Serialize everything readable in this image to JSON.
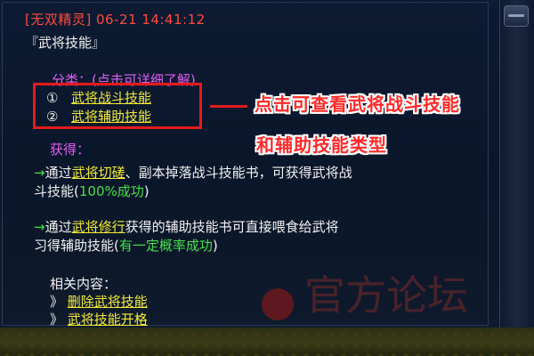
{
  "header": {
    "text": "[无双精灵] 06-21 14:41:12"
  },
  "title": "『武将技能』",
  "category_label": "分类：(点击可详细了解)",
  "options": [
    {
      "num": "①",
      "label": "武将战斗技能"
    },
    {
      "num": "②",
      "label": "武将辅助技能"
    }
  ],
  "annotation": {
    "line1": "点击可查看武将战斗技能",
    "line2": "和辅助技能类型"
  },
  "gain": {
    "label": "获得：",
    "p1": {
      "arrow": "→",
      "pre": "通过",
      "link": "武将切磋",
      "post": "、副本掉落战斗技能书，可获得武将战",
      "line2_pre": "斗技能(",
      "line2_pct": "100%成功",
      "line2_post": ")"
    },
    "p2": {
      "arrow": "→",
      "pre": "通过",
      "link": "武将修行",
      "post": "获得的辅助技能书可直接喂食给武将",
      "line2_pre": "习得辅助技能(",
      "line2_pct": "有一定概率成功",
      "line2_post": ")"
    }
  },
  "related": {
    "label": "相关内容：",
    "items": [
      {
        "marker": "》",
        "label": "删除武将技能"
      },
      {
        "marker": "》",
        "label": "武将技能开格"
      }
    ]
  },
  "watermark": "官方论坛",
  "colors": {
    "header_red": "#ff4b3e",
    "purple": "#e35ef5",
    "link_yellow": "#f4ea36",
    "green": "#45e04a",
    "box_red": "#e31c1c"
  }
}
